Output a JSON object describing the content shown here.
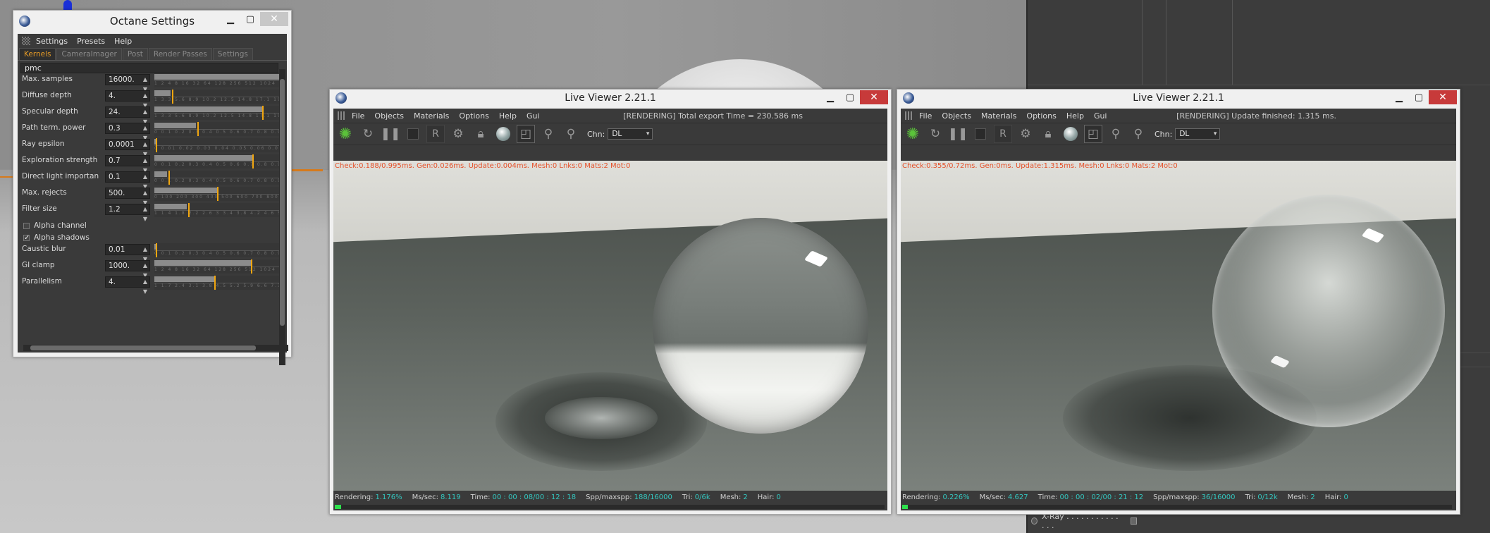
{
  "octane": {
    "title": "Octane Settings",
    "menu": [
      "Settings",
      "Presets",
      "Help"
    ],
    "tabs": [
      {
        "label": "Kernels",
        "active": true
      },
      {
        "label": "CameraImager",
        "active": false
      },
      {
        "label": "Post",
        "active": false
      },
      {
        "label": "Render Passes",
        "active": false
      },
      {
        "label": "Settings",
        "active": false
      }
    ],
    "kernel": "pmc",
    "params": [
      {
        "label": "Max. samples",
        "value": "16000.",
        "fill": 1.0,
        "knob": null,
        "ticks": "1 2 4 8 16 32 64 128 256 512 1024 2048"
      },
      {
        "label": "Diffuse depth",
        "value": "4.",
        "fill": 0.13,
        "knob": 0.14,
        "ticks": "1 3.3 5.6 8.9 10.2 12.5 14.8 17.1 19.4 21.7 24"
      },
      {
        "label": "Specular depth",
        "value": "24.",
        "fill": 0.86,
        "knob": 0.86,
        "ticks": "1 3.3 5.6 8.9 10.2 12.5 14.8 17.1 19.4 21.7 24"
      },
      {
        "label": "Path term. power",
        "value": "0.3",
        "fill": 0.33,
        "knob": 0.34,
        "ticks": "0 0.1 0.2 0.3 0.4 0.5 0.6 0.7 0.8 0.9 1"
      },
      {
        "label": "Ray epsilon",
        "value": "0.0001",
        "fill": 0.01,
        "knob": 0.01,
        "ticks": "0 0.01 0.02 0.03 0.04 0.05 0.06 0.07 0.08 0.09"
      },
      {
        "label": "Exploration strength",
        "value": "0.7",
        "fill": 0.78,
        "knob": 0.78,
        "ticks": "0 0.1 0.2 0.3 0.4 0.5 0.6 0.7 0.8 0.9 1"
      },
      {
        "label": "Direct light importan",
        "value": "0.1",
        "fill": 0.1,
        "knob": 0.11,
        "ticks": "0 0.1 0.2 0.3 0.4 0.5 0.6 0.7 0.8 0.9 1"
      },
      {
        "label": "Max.  rejects",
        "value": "500.",
        "fill": 0.5,
        "knob": 0.5,
        "ticks": "0 100 200 300 400 500 600 700 800 900 1000"
      },
      {
        "label": "Filter size",
        "value": "1.2",
        "fill": 0.26,
        "knob": 0.27,
        "ticks": "1 1.4 1.8 2.2 2.6 3 3.4 3.8 4.2 4.6 5"
      },
      {
        "label": "Caustic blur",
        "value": "0.01",
        "fill": 0.01,
        "knob": 0.01,
        "ticks": "0 0.1 0.2 0.3 0.4 0.5 0.6 0.7 0.8 0.9 1"
      },
      {
        "label": "GI clamp",
        "value": "1000.",
        "fill": 0.77,
        "knob": 0.77,
        "ticks": "1 2 4 8 16 32 64 128 256 512 1024"
      },
      {
        "label": "Parallelism",
        "value": "4.",
        "fill": 0.48,
        "knob": 0.48,
        "ticks": "1 1.7 2.4 3.1 3.8 4.5 5.2 5.9 6.6 7.3 8"
      }
    ],
    "checks": [
      {
        "label": "Alpha channel",
        "checked": false
      },
      {
        "label": "Alpha shadows",
        "checked": true
      }
    ]
  },
  "viewers": [
    {
      "title": "Live Viewer 2.21.1",
      "menu": [
        "File",
        "Objects",
        "Materials",
        "Options",
        "Help",
        "Gui"
      ],
      "status": "[RENDERING] Total export Time = 230.586 ms",
      "channel_label": "Chn:",
      "channel": "DL",
      "diag": "Check:0.188/0.995ms. Gen:0.026ms. Update:0.004ms. Mesh:0 Lnks:0 Mats:2 Mot:0",
      "footer": [
        {
          "k": "Rendering:",
          "v": "1.176%"
        },
        {
          "k": "Ms/sec:",
          "v": "8.119"
        },
        {
          "k": "Time:",
          "v": "00 : 00 : 08/00 : 12 : 18"
        },
        {
          "k": "Spp/maxspp:",
          "v": "188/16000"
        },
        {
          "k": "Tri:",
          "v": "0/6k"
        },
        {
          "k": "Mesh:",
          "v": "2"
        },
        {
          "k": "Hair:",
          "v": "0"
        }
      ],
      "progress": 0.012
    },
    {
      "title": "Live Viewer 2.21.1",
      "menu": [
        "File",
        "Objects",
        "Materials",
        "Options",
        "Help",
        "Gui"
      ],
      "status": "[RENDERING] Update finished: 1.315 ms.",
      "channel_label": "Chn:",
      "channel": "DL",
      "diag": "Check:0.355/0.72ms. Gen:0ms. Update:1.315ms. Mesh:0 Lnks:0 Mats:2 Mot:0",
      "footer": [
        {
          "k": "Rendering:",
          "v": "0.226%"
        },
        {
          "k": "Ms/sec:",
          "v": "4.627"
        },
        {
          "k": "Time:",
          "v": "00 : 00 : 02/00 : 21 : 12"
        },
        {
          "k": "Spp/maxspp:",
          "v": "36/16000"
        },
        {
          "k": "Tri:",
          "v": "0/12k"
        },
        {
          "k": "Mesh:",
          "v": "2"
        },
        {
          "k": "Hair:",
          "v": "0"
        }
      ],
      "progress": 0.002
    }
  ],
  "c4d": {
    "xray_label": "X-Ray . . . . . . . . . . . . . ."
  },
  "colors": {
    "accent_tab": "#e49a27",
    "slider_knob": "#f1a60f",
    "diag_text": "#e5512a",
    "footer_value": "#34c7c0",
    "progress_fill": "#2ee04d"
  }
}
